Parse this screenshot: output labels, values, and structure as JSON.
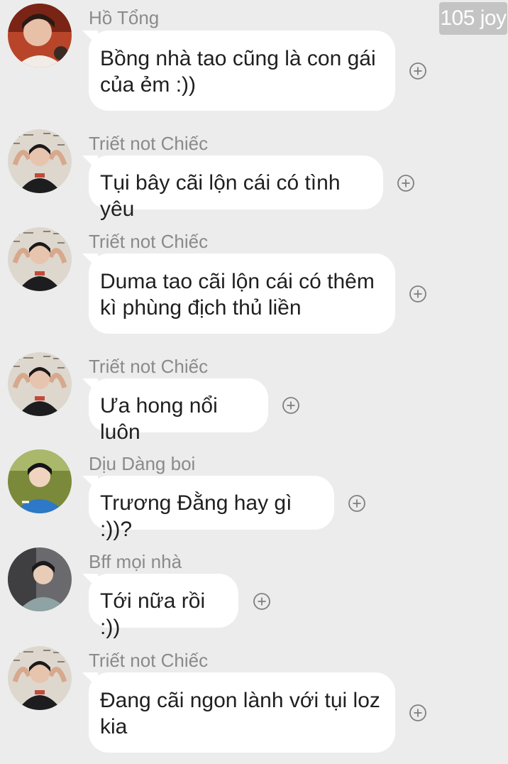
{
  "watermark": "105 joy",
  "colors": {
    "background": "#ececec",
    "bubble": "#ffffff",
    "sender_name": "#8a8a8a",
    "message_text": "#1f1f1f"
  },
  "icons": {
    "react": "add-reaction-icon"
  },
  "messages": [
    {
      "sender": "Hồ Tổng",
      "avatar": "avatar-ho-tong",
      "text": "Bồng nhà tao cũng là con gái\ncủa ẻm :))"
    },
    {
      "sender": "Triết not Chiếc",
      "avatar": "avatar-triet",
      "text": "Tụi bây cãi lộn cái có tình yêu"
    },
    {
      "sender": "Triết not Chiếc",
      "avatar": "avatar-triet",
      "text": "Duma tao cãi lộn cái có thêm\nkì phùng địch thủ liền"
    },
    {
      "sender": "Triết not Chiếc",
      "avatar": "avatar-triet",
      "text": "Ưa hong nổi luôn"
    },
    {
      "sender": "Dịu Dàng boi",
      "avatar": "avatar-diu-dang",
      "text": "Trương Đằng hay gì :))?"
    },
    {
      "sender": "Bff mọi nhà",
      "avatar": "avatar-bff",
      "text": "Tới nữa rồi :))"
    },
    {
      "sender": "Triết not Chiếc",
      "avatar": "avatar-triet",
      "text": "Đang cãi ngon lành với tụi loz\nkia"
    }
  ]
}
